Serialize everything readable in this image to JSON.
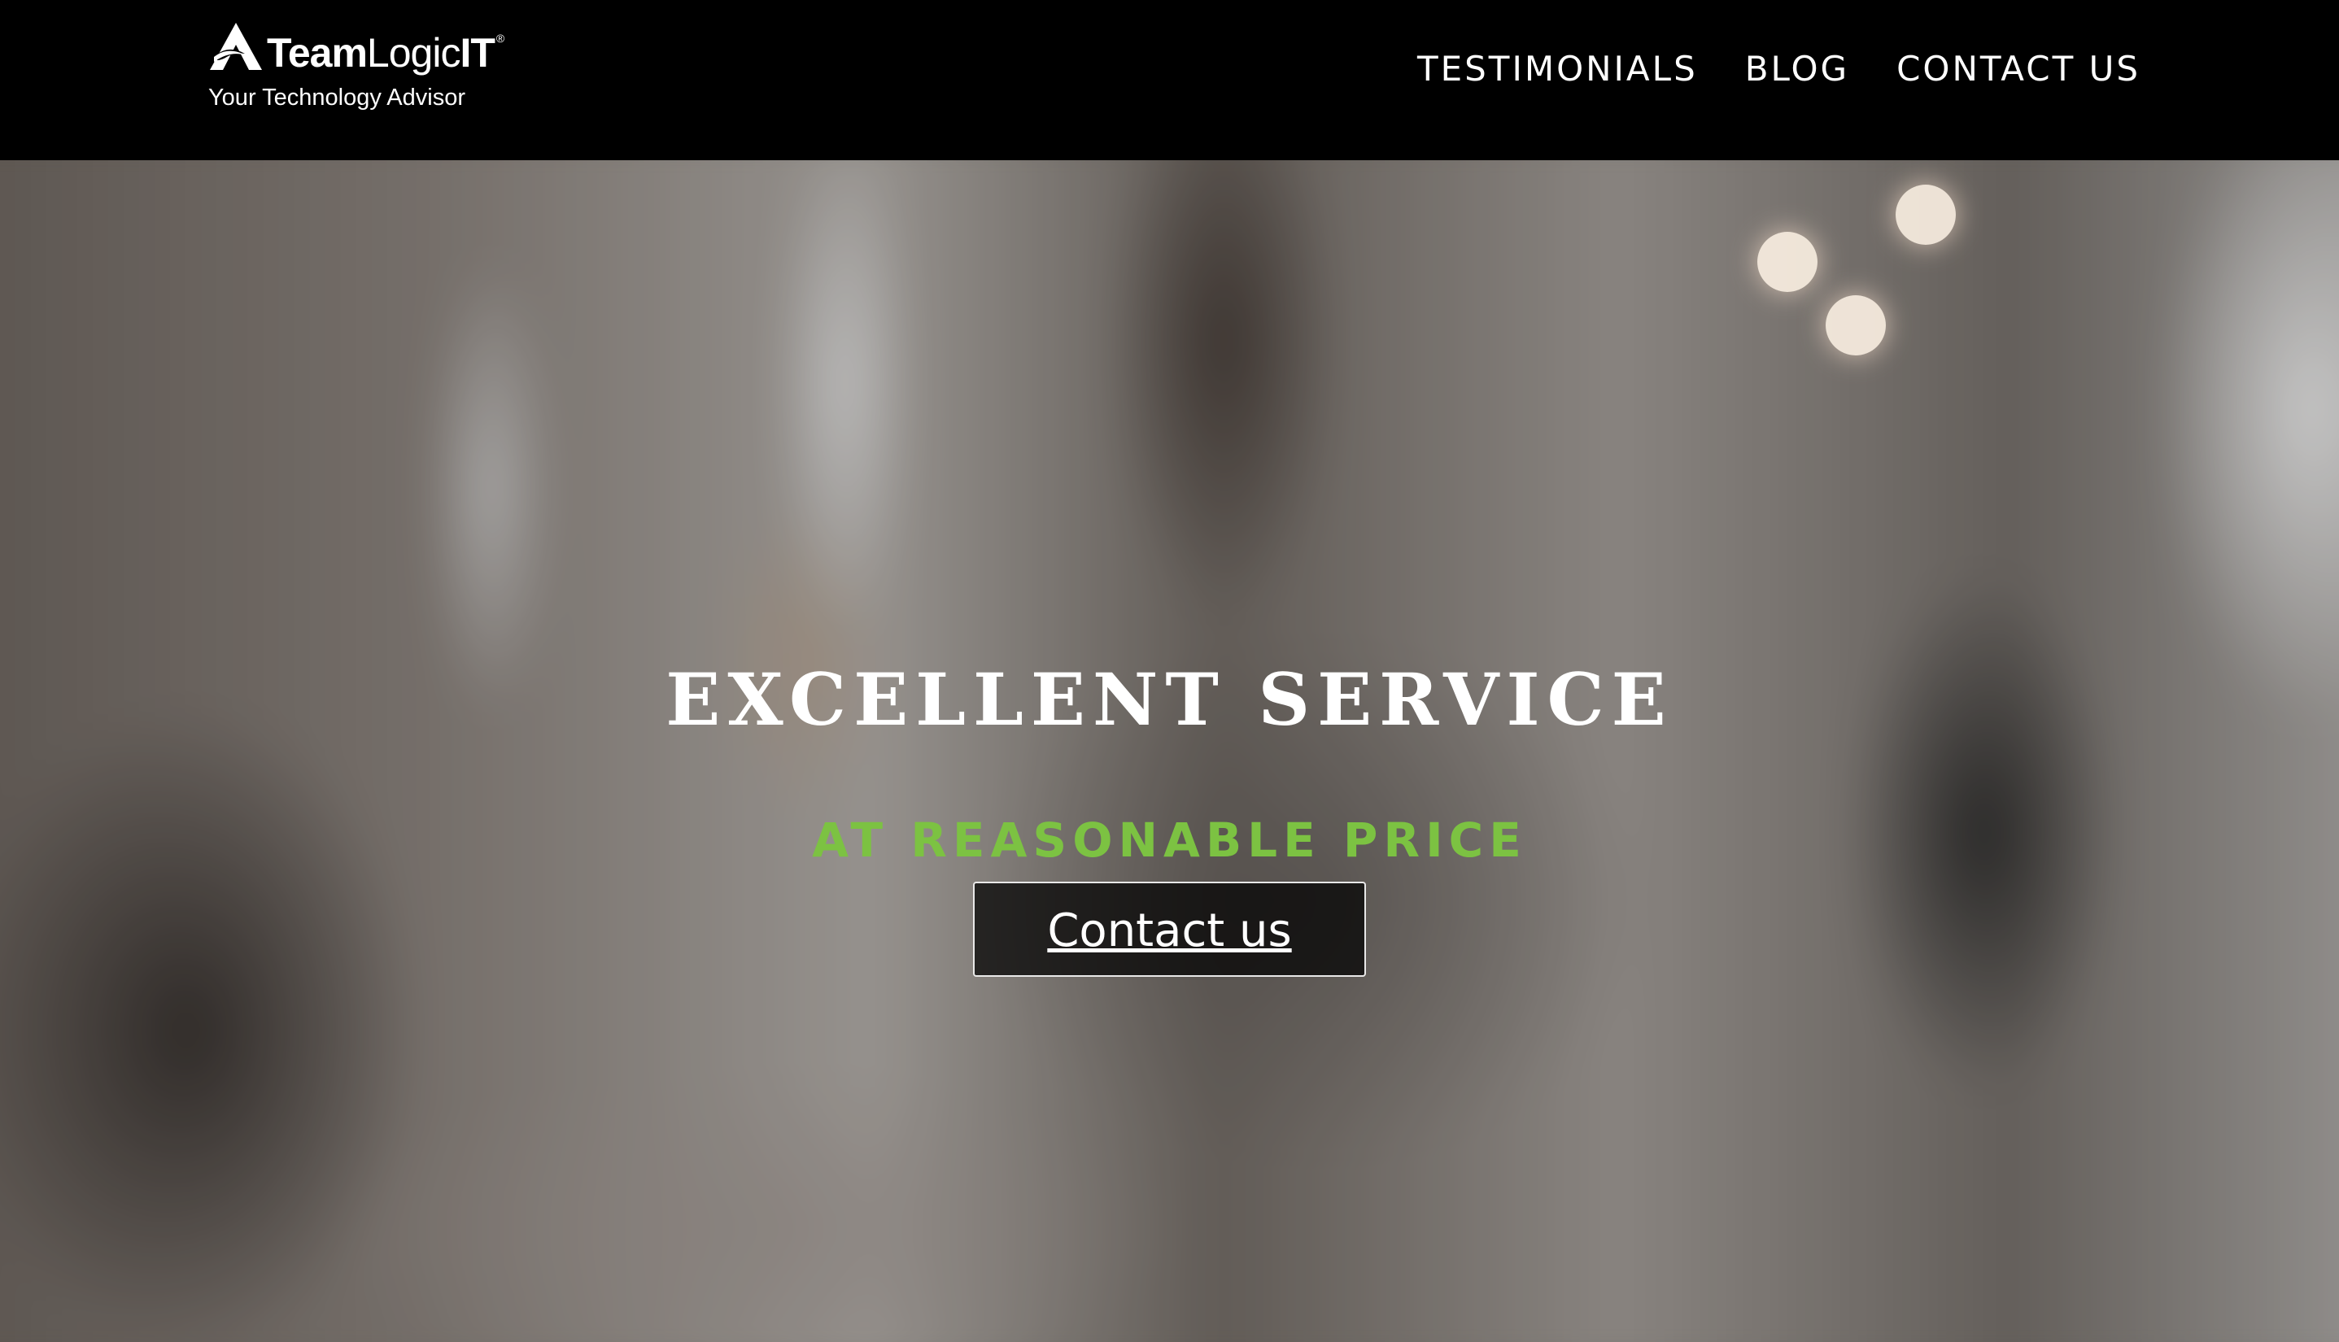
{
  "header": {
    "logo": {
      "brand_bold": "Team",
      "brand_light": "Logic",
      "brand_suffix": "IT",
      "registered_mark": "®",
      "tagline": "Your Technology Advisor"
    },
    "nav": {
      "items": [
        "TESTIMONIALS",
        "BLOG",
        "CONTACT US"
      ]
    }
  },
  "hero": {
    "headline": "EXCELLENT SERVICE",
    "subheadline": "AT REASONABLE PRICE",
    "cta_label": "Contact us"
  },
  "colors": {
    "header_bg": "#000000",
    "accent_green": "#7cc242",
    "text_white": "#ffffff"
  }
}
